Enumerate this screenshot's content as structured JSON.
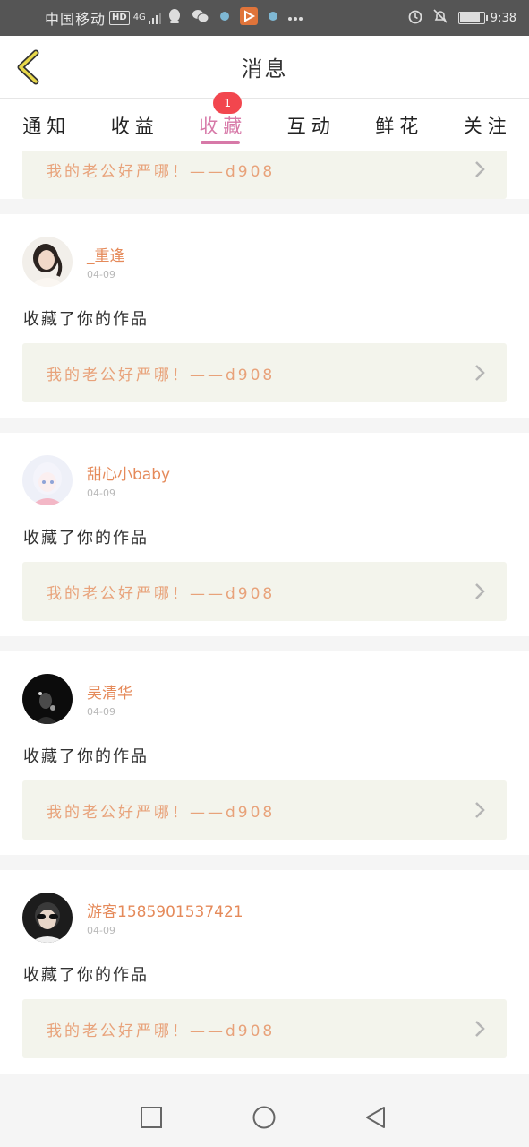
{
  "status_bar": {
    "carrier": "中国移动",
    "hd_badge": "HD",
    "network_small": "4G",
    "time": "9:38",
    "battery_level": 0.8,
    "icons": [
      "qq-icon",
      "wechat-icon",
      "app-icon",
      "pinwheel-icon",
      "more-dots-icon",
      "alarm-icon",
      "bell-off-icon",
      "battery-icon"
    ]
  },
  "header": {
    "title": "消息",
    "back_icon": "chevron-left-icon"
  },
  "tabs": [
    {
      "label": "通知",
      "active": false
    },
    {
      "label": "收益",
      "active": false
    },
    {
      "label": "收藏",
      "active": true,
      "badge": "1"
    },
    {
      "label": "互动",
      "active": false
    },
    {
      "label": "鲜花",
      "active": false
    },
    {
      "label": "关注",
      "active": false
    }
  ],
  "partial_card": {
    "work_title": "我的老公好严哪！——d908"
  },
  "notifications": [
    {
      "username": "_重逢",
      "date": "04-09",
      "action": "收藏了你的作品",
      "work_title": "我的老公好严哪！——d908"
    },
    {
      "username": "甜心小baby",
      "date": "04-09",
      "action": "收藏了你的作品",
      "work_title": "我的老公好严哪！——d908"
    },
    {
      "username": "吴清华",
      "date": "04-09",
      "action": "收藏了你的作品",
      "work_title": "我的老公好严哪！——d908"
    },
    {
      "username": "游客1585901537421",
      "date": "04-09",
      "action": "收藏了你的作品",
      "work_title": "我的老公好严哪！——d908"
    }
  ],
  "colors": {
    "accent": "#d779a8",
    "badge": "#f2464e",
    "username": "#e58a5a",
    "work_title": "#e8a27a",
    "back_arrow": "#e8d84a"
  },
  "nav": [
    "square-icon",
    "circle-icon",
    "triangle-back-icon"
  ]
}
